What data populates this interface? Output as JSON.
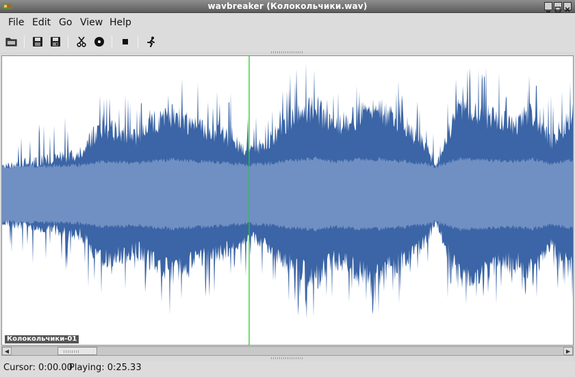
{
  "window": {
    "title": "wavbreaker (Колокольчики.wav)"
  },
  "menu": {
    "file": "File",
    "edit": "Edit",
    "go": "Go",
    "view": "View",
    "help": "Help"
  },
  "toolbar": {
    "icons": [
      "open-file-icon",
      "save-icon",
      "save-as-icon",
      "cut-icon",
      "cd-icon",
      "stop-icon",
      "run-icon"
    ]
  },
  "waveform": {
    "track_label": "Колокольчики-01",
    "colors": {
      "outer": "#3b65a6",
      "inner": "#7090c3",
      "cursor": "#22cc22",
      "background": "#ffffff"
    },
    "playback_position_fraction": 0.433
  },
  "scrollbar": {
    "position_fraction": 0.09
  },
  "status": {
    "cursor_text": "Cursor: 0:00.00",
    "playing_text": "Playing: 0:25.33"
  }
}
